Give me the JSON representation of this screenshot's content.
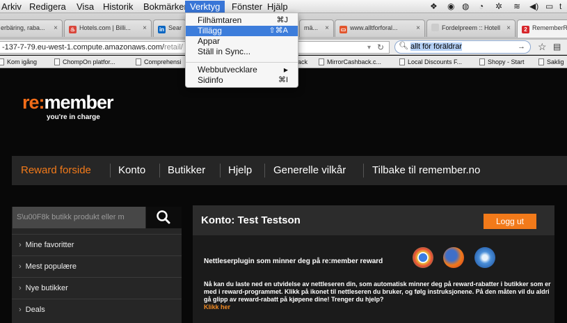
{
  "menubar": {
    "items": [
      "Arkiv",
      "Redigera",
      "Visa",
      "Historik",
      "Bokmärken",
      "Verktyg",
      "Fönster",
      "Hjälp"
    ],
    "active": "Verktyg",
    "right_partial": "t"
  },
  "tabs": [
    {
      "label": "erbäring, raba..."
    },
    {
      "label": "Hotels.com | Billi..."
    },
    {
      "label": "Sear"
    },
    {
      "label": "mä..."
    },
    {
      "label": "www.alltforforal..."
    },
    {
      "label": "Fordelpreem :: Hotell"
    },
    {
      "label": "RememberR"
    }
  ],
  "tab_close": "×",
  "toolbar": {
    "url_main": "-137-7-79.eu-west-1.compute.amazonaws.com/",
    "url_dim": "retail/",
    "search_value": "allt för föräldrar"
  },
  "bookmarks": [
    "Kom igång",
    "ChompOn platfor...",
    "Comprehensi",
    "ack",
    "MirrorCashback.c...",
    "Local Discounts F...",
    "Shopy - Start",
    "Saklig"
  ],
  "tools_menu": {
    "items": [
      {
        "label": "Filhämtaren",
        "shortcut": "⌘J"
      },
      {
        "label": "Tillägg",
        "shortcut": "⇧⌘A"
      },
      {
        "label": "Appar",
        "shortcut": ""
      },
      {
        "label": "Ställ in Sync...",
        "shortcut": ""
      },
      {
        "label": "Webbutvecklare",
        "shortcut": "▶"
      },
      {
        "label": "Sidinfo",
        "shortcut": "⌘I"
      }
    ]
  },
  "site": {
    "logo_re": "re:",
    "logo_member": "member",
    "tagline": "you're in charge",
    "nav": [
      "Reward forside",
      "Konto",
      "Butikker",
      "Hjelp",
      "Generelle vilkår",
      "Tilbake til remember.no"
    ],
    "search_placeholder": "S\\u00F8k butikk produkt eller m",
    "search_icon_label": "search-icon",
    "sidebar_items": [
      "Mine favoritter",
      "Mest populære",
      "Nye butikker",
      "Deals"
    ],
    "account_title": "Konto: Test Testson",
    "logout": "Logg ut",
    "plugin_title": "Nettleserplugin som minner deg på re:member reward",
    "plugin_desc": "Nå kan du laste ned en utvidelse av nettleseren din, som automatisk minner deg på reward-rabatter i butikker som er med i reward-programmet. Klikk på ikonet til nettleseren du bruker, og følg instruksjonene. På den måten vil du aldri gå glipp av reward-rabatt på kjøpene dine! Trenger du hjelp?",
    "plugin_link": "Klikk her"
  },
  "colors": {
    "accent": "#f27a1a",
    "menu_highlight": "#3d7ddb"
  }
}
